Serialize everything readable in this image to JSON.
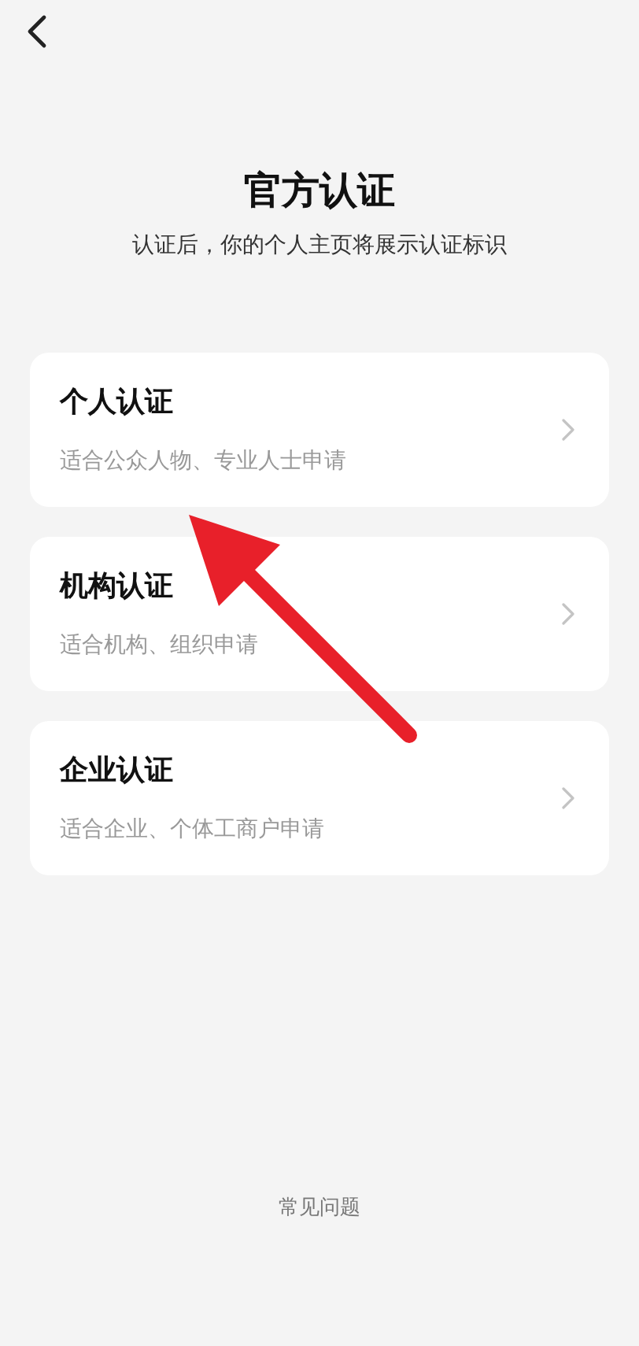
{
  "title": "官方认证",
  "subtitle": "认证后，你的个人主页将展示认证标识",
  "options": [
    {
      "title": "个人认证",
      "description": "适合公众人物、专业人士申请"
    },
    {
      "title": "机构认证",
      "description": "适合机构、组织申请"
    },
    {
      "title": "企业认证",
      "description": "适合企业、个体工商户申请"
    }
  ],
  "footer_link": "常见问题",
  "annotation": {
    "kind": "arrow"
  }
}
